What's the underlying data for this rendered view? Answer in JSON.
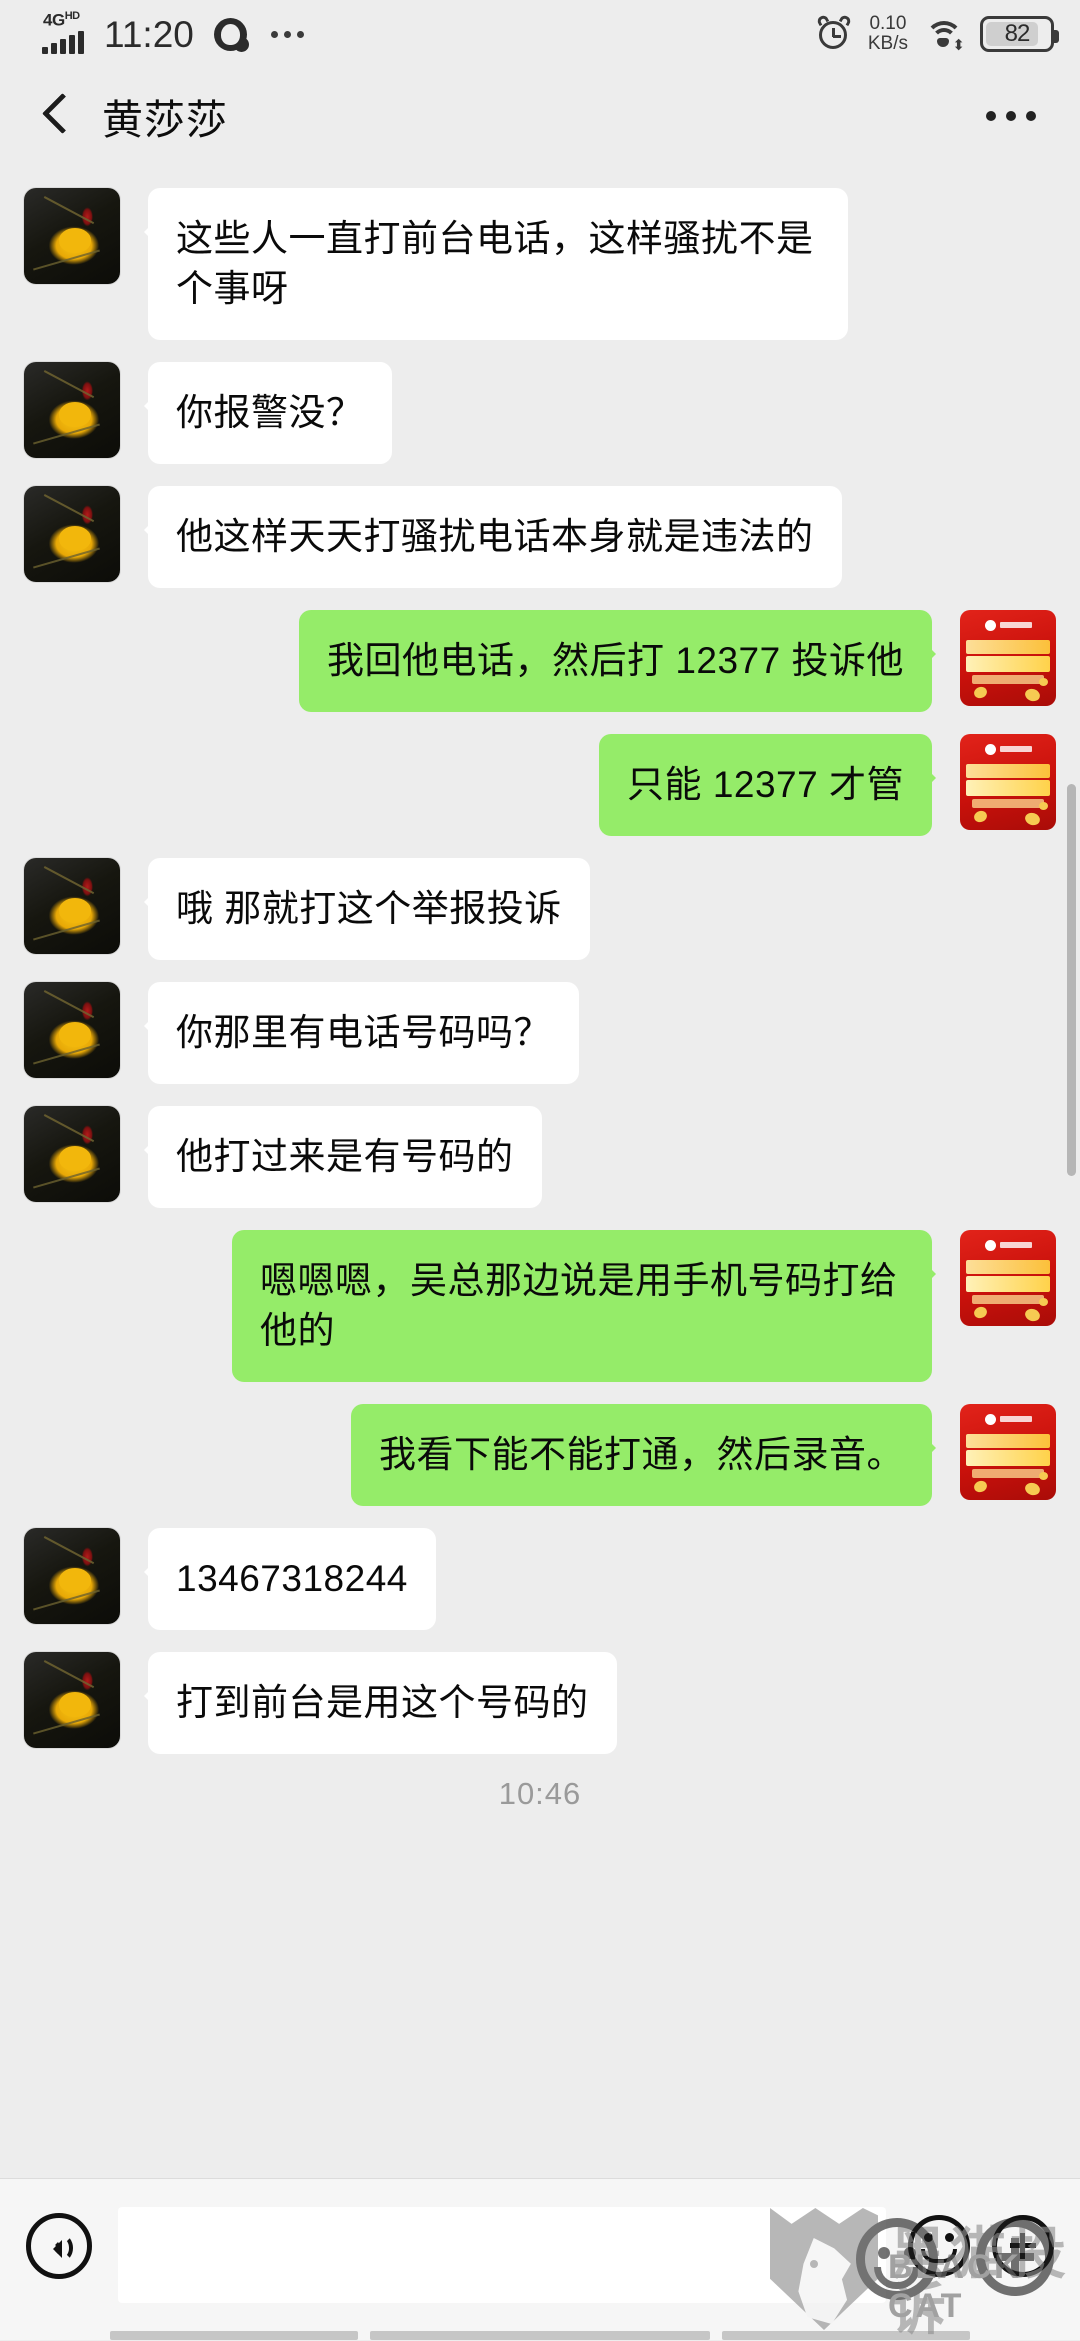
{
  "statusbar": {
    "network_type": "4G",
    "network_suffix": "HD",
    "time": "11:20",
    "net_speed_value": "0.10",
    "net_speed_unit": "KB/s",
    "battery_level": "82"
  },
  "header": {
    "title": "黄莎莎",
    "back_icon": "chevron-left-icon",
    "menu_icon": "more-horizontal-icon"
  },
  "colors": {
    "background": "#EDEDED",
    "incoming_bubble": "#FFFFFF",
    "outgoing_bubble": "#95EC69",
    "link": "#5A7FB5",
    "timestamp": "#9A9A9A"
  },
  "messages": [
    {
      "side": "in",
      "text": "这些人一直打前台电话，这样骚扰不是个事呀"
    },
    {
      "side": "in",
      "text": "你报警没？"
    },
    {
      "side": "in",
      "text": "他这样天天打骚扰电话本身就是违法的"
    },
    {
      "side": "out",
      "text": "我回他电话，然后打 12377 投诉他"
    },
    {
      "side": "out",
      "text": "只能 12377 才管"
    },
    {
      "side": "in",
      "text": "哦  那就打这个举报投诉"
    },
    {
      "side": "in",
      "text": "你那里有电话号码吗？"
    },
    {
      "side": "in",
      "text": "他打过来是有号码的"
    },
    {
      "side": "out",
      "text": "嗯嗯嗯，吴总那边说是用手机号码打给他的"
    },
    {
      "side": "out",
      "text": "我看下能不能打通，然后录音。"
    },
    {
      "side": "in",
      "text": "13467318244",
      "is_link": true
    },
    {
      "side": "in",
      "text": "打到前台是用这个号码的"
    }
  ],
  "timestamp": "10:46",
  "inputbar": {
    "voice_icon": "voice-record-icon",
    "input_value": "",
    "input_placeholder": "",
    "emoji_icon": "emoji-smiley-icon",
    "plus_icon": "plus-circle-icon"
  },
  "watermark": {
    "cn_text": "黑猫投诉",
    "en_text": "BLACK CAT"
  }
}
